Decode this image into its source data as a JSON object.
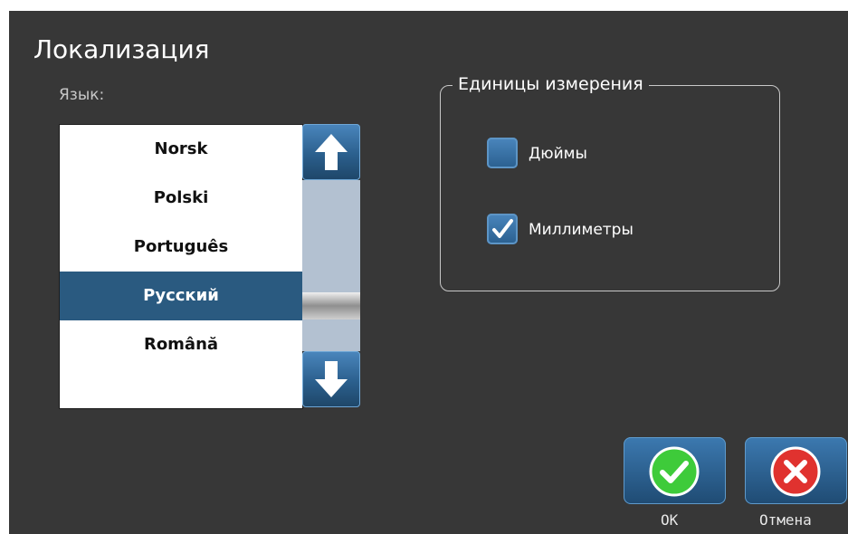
{
  "dialog": {
    "title": "Локализация"
  },
  "language": {
    "label": "Язык:",
    "options": [
      "Norsk",
      "Polski",
      "Português",
      "Русский",
      "Română"
    ],
    "selected": "Русский",
    "icons": {
      "scroll_up": "arrow-up-icon",
      "scroll_down": "arrow-down-icon"
    }
  },
  "units": {
    "legend": "Единицы измерения",
    "options": [
      {
        "label": "Дюймы",
        "checked": false
      },
      {
        "label": "Миллиметры",
        "checked": true
      }
    ]
  },
  "actions": {
    "ok_label": "OK",
    "cancel_label": "Отмена",
    "icons": {
      "ok": "checkmark-circle-icon",
      "cancel": "close-circle-icon"
    }
  },
  "colors": {
    "background": "#373737",
    "selection": "#2a5a80",
    "button_blue": "#2b5f8d",
    "ok_green": "#3ecb3a",
    "cancel_red": "#e0322f"
  }
}
